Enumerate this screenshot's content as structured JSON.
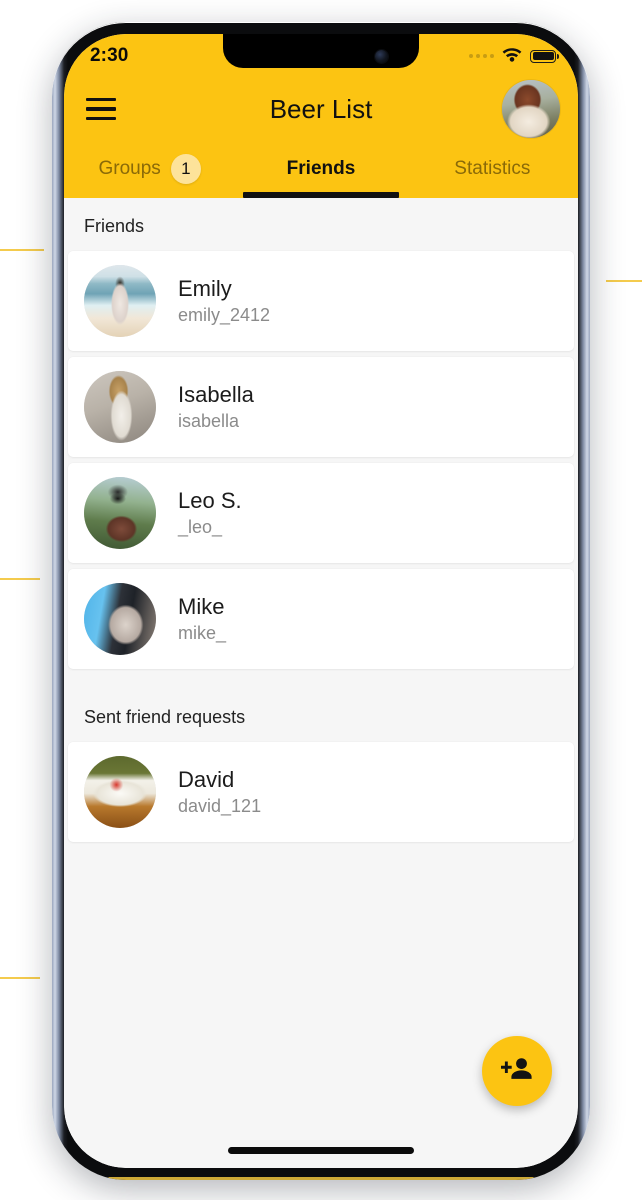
{
  "device": {
    "status_bar": {
      "time": "2:30",
      "signal_icon": "cellular-dots-icon",
      "wifi_icon": "wifi-icon",
      "battery_icon": "battery-full-icon"
    },
    "home_indicator": "home-indicator"
  },
  "header": {
    "menu_icon": "hamburger-menu-icon",
    "title": "Beer List",
    "avatar": "self-avatar",
    "background_color": "#fcc412",
    "text_color": "#111111"
  },
  "tabs": [
    {
      "label": "Groups",
      "active": false,
      "badge": "1"
    },
    {
      "label": "Friends",
      "active": true,
      "badge": null
    },
    {
      "label": "Statistics",
      "active": false,
      "badge": null
    }
  ],
  "sections": [
    {
      "title": "Friends",
      "rows": [
        {
          "name": "Emily",
          "handle": "emily_2412",
          "avatar": "avatar-emily"
        },
        {
          "name": "Isabella",
          "handle": "isabella",
          "avatar": "avatar-isabella"
        },
        {
          "name": "Leo S.",
          "handle": "_leo_",
          "avatar": "avatar-leo"
        },
        {
          "name": "Mike",
          "handle": "mike_",
          "avatar": "avatar-mike"
        }
      ]
    },
    {
      "title": "Sent friend requests",
      "rows": [
        {
          "name": "David",
          "handle": "david_121",
          "avatar": "avatar-david"
        }
      ]
    }
  ],
  "fab": {
    "icon": "person-add-icon",
    "label": "Add friend",
    "background_color": "#fcc412"
  },
  "theme": {
    "accent": "#fcc412",
    "badge_bg": "#fde39a",
    "content_bg": "#f6f6f6",
    "card_bg": "#ffffff",
    "name_color": "#1c1c1c",
    "handle_color": "#8b8b8b",
    "inactive_tab_color": "#8a6a08"
  }
}
